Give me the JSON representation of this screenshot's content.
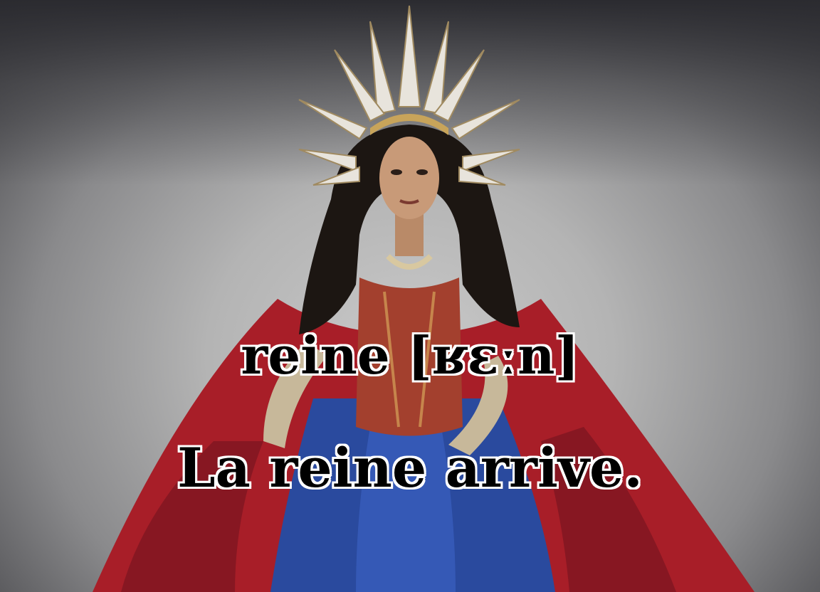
{
  "caption": {
    "word_line": "reine [ʁɛːn]",
    "sentence_line": "La reine arrive."
  },
  "scene": {
    "subject": "queen-portrait",
    "colors": {
      "background": "#b4b4b4",
      "cape_red": "#b3202a",
      "gown_blue": "#2a4a9e",
      "crown_gold": "#c8a45a",
      "hair": "#1c1612",
      "skin": "#c89a78"
    }
  }
}
